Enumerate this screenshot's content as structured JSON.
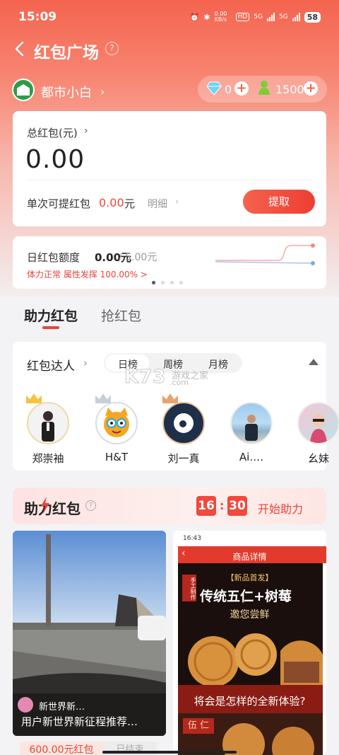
{
  "status_bar": {
    "time": "15:09",
    "speed": "0.00 KB/s",
    "network_a": "5G",
    "network_b": "5G",
    "battery": "58"
  },
  "header": {
    "title": "红包广场",
    "help": "?"
  },
  "user": {
    "name": "都市小白",
    "diamonds": "0",
    "coins": "1500"
  },
  "wallet": {
    "total_label": "总红包(元)",
    "total_amount": "0.00",
    "withdraw_label": "单次可提红包",
    "withdraw_amount": "0.00",
    "withdraw_unit": "元",
    "detail_label": "明细",
    "withdraw_button": "提取"
  },
  "quota": {
    "label": "日红包额度",
    "value": "0.00元",
    "max": "/ 5.00元",
    "status": "体力正常  属性发挥  100.00%  >"
  },
  "tabs": [
    {
      "label": "助力红包"
    },
    {
      "label": "抢红包"
    }
  ],
  "ranking": {
    "title": "红包达人",
    "periods": [
      "日榜",
      "周榜",
      "月榜"
    ],
    "users": [
      {
        "name": "郑崇袖"
      },
      {
        "name": "H&T"
      },
      {
        "name": "刘一真"
      },
      {
        "name": "Ai.…"
      },
      {
        "name": "幺妹"
      }
    ]
  },
  "watermark": {
    "logo": "K73",
    "sub": "游戏之家",
    "url": ".com"
  },
  "help_section": {
    "title": "助力红包",
    "timer_hours": "16",
    "timer_minutes": "30",
    "start_label": "开始助力"
  },
  "posts": [
    {
      "author": "新世界新…",
      "caption": "用户新世界新征程推荐…",
      "reward": "600.00元红包",
      "status": "已结束"
    },
    {
      "screen_time": "16:43",
      "screen_title": "商品详情",
      "badge": "【新品首发】",
      "headline": "传统五仁+树莓",
      "sub": "邀您尝鲜",
      "tag": "手工制作",
      "promo": "将会是怎样的全新体验?",
      "label": "伍 仁"
    }
  ],
  "colors": {
    "accent": "#e8453a",
    "header_gradient_top": "#f4644f"
  }
}
